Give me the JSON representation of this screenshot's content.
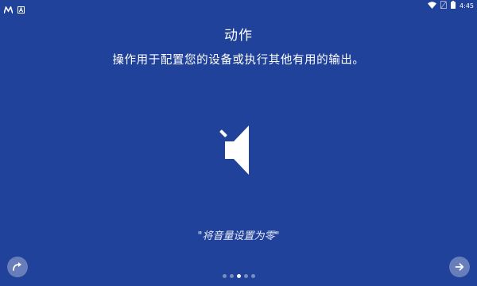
{
  "status_bar": {
    "left_icons": [
      "maps-icon",
      "font-icon"
    ],
    "right_icons": [
      "wifi-icon",
      "no-sim-icon",
      "battery-icon"
    ],
    "time": "4:45"
  },
  "page": {
    "title": "动作",
    "subtitle": "操作用于配置您的设备或执行其他有用的输出。",
    "hero_icon": "speaker-muted-icon",
    "caption": "\"将音量设置为零\""
  },
  "pager": {
    "total": 5,
    "active_index": 2
  },
  "colors": {
    "background": "#20429a",
    "text": "#ffffff"
  }
}
